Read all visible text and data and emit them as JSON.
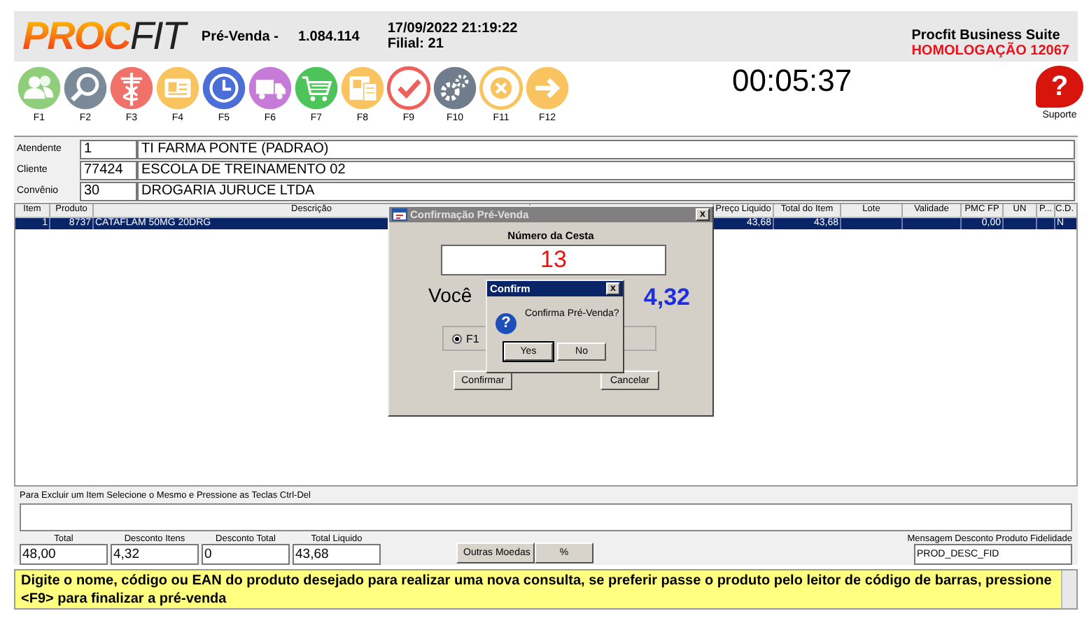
{
  "header": {
    "logo": {
      "left": "PROC",
      "right": "FIT"
    },
    "module": "Pré-Venda -",
    "version": "1.084.114",
    "datetime": "17/09/2022 21:19:22",
    "branch": "Filial: 21",
    "suite": "Procfit Business Suite",
    "environment": "HOMOLOGAÇÃO 12067"
  },
  "toolbar": {
    "keys": [
      {
        "label": "F1",
        "kind": "people",
        "color": "#8fce7a"
      },
      {
        "label": "F2",
        "kind": "search",
        "color": "#7b8a99"
      },
      {
        "label": "F3",
        "kind": "medical",
        "color": "#f0706a"
      },
      {
        "label": "F4",
        "kind": "card",
        "color": "#f9c460"
      },
      {
        "label": "F5",
        "kind": "clock",
        "color": "#4b6fd6"
      },
      {
        "label": "F6",
        "kind": "truck",
        "color": "#c77bd8"
      },
      {
        "label": "F7",
        "kind": "cart",
        "color": "#4cc45a"
      },
      {
        "label": "F8",
        "kind": "document",
        "color": "#f9c460"
      },
      {
        "label": "F9",
        "kind": "check",
        "color": "#f0605a"
      },
      {
        "label": "F10",
        "kind": "gears",
        "color": "#6f7d8c"
      },
      {
        "label": "F11",
        "kind": "cancel",
        "color": "#f9c460"
      },
      {
        "label": "F12",
        "kind": "arrow",
        "color": "#f9c460"
      }
    ],
    "timer": "00:05:37",
    "support": {
      "glyph": "?",
      "label": "Suporte"
    }
  },
  "fields": [
    {
      "label": "Atendente",
      "code": "1",
      "value": "TI FARMA PONTE (PADRAO)"
    },
    {
      "label": "Cliente",
      "code": "77424",
      "value": "ESCOLA DE TREINAMENTO 02"
    },
    {
      "label": "Convênio",
      "code": "30",
      "value": "DROGARIA JURUCE LTDA"
    }
  ],
  "table": {
    "columns": [
      "Item",
      "Produto",
      "Descrição",
      "Preço Liquido",
      "Total do Item",
      "Lote",
      "Validade",
      "PMC FP",
      "UN",
      "P...",
      "C.D."
    ],
    "rows": [
      {
        "selected": true,
        "cells": [
          "1",
          "8737",
          "CATAFLAM 50MG 20DRG",
          "43,68",
          "43,68",
          null,
          null,
          "0,00",
          null,
          null,
          "N"
        ]
      }
    ]
  },
  "basket_dialog": {
    "title": "Confirmação Pré-Venda",
    "close": "x",
    "number_label": "Número da Cesta",
    "number": "13",
    "saving_text": "Você",
    "saving_value": "4,32",
    "radio": {
      "label": "F1",
      "selected": true
    },
    "buttons": [
      "Confirmar",
      "Cancelar"
    ]
  },
  "confirm_dialog": {
    "title": "Confirm",
    "close": "x",
    "glyph": "?",
    "message": "Confirma Pré-Venda?",
    "buttons": [
      {
        "label": "Yes",
        "default": true
      },
      {
        "label": "No",
        "default": false
      }
    ]
  },
  "delete_hint": "Para Excluir um Item Selecione o Mesmo e Pressione as Teclas Ctrl-Del",
  "totals": [
    {
      "label": "Total",
      "value": "48,00"
    },
    {
      "label": "Desconto Itens",
      "value": "4,32"
    },
    {
      "label": "Desconto Total",
      "value": "0"
    },
    {
      "label": "Total Liquido",
      "value": "43,68"
    }
  ],
  "actions": [
    "Outras Moedas",
    "%"
  ],
  "loyalty": {
    "label": "Mensagem Desconto Produto Fidelidade",
    "value": "PROD_DESC_FID"
  },
  "status_message": "Digite o nome, código ou EAN do produto desejado para realizar uma nova consulta, se preferir passe o produto pelo leitor de código de barras, pressione <F9> para finalizar a pré-venda"
}
